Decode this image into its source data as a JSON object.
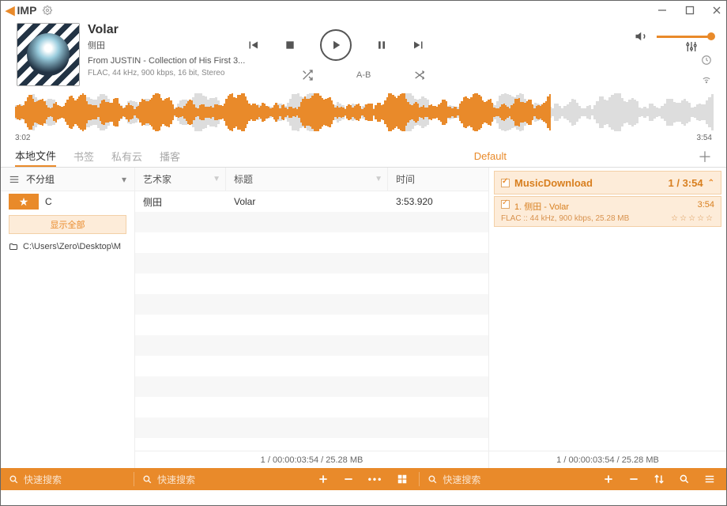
{
  "app_name": "IMP",
  "track": {
    "title": "Volar",
    "artist": "侧田",
    "album": "From JUSTIN - Collection of His First 3...",
    "spec": "FLAC, 44 kHz, 900 kbps, 16 bit, Stereo"
  },
  "mode": {
    "ab": "A-B"
  },
  "time": {
    "current": "3:02",
    "total": "3:54",
    "progress_pct": 77
  },
  "tabs": [
    "本地文件",
    "书签",
    "私有云",
    "播客"
  ],
  "right_title": "Default",
  "left": {
    "group_label": "不分组",
    "star_letter": "C",
    "show_all": "显示全部",
    "folder": "C:\\Users\\Zero\\Desktop\\M"
  },
  "columns": {
    "artist": "艺术家",
    "title": "标题",
    "time": "时间"
  },
  "rows": [
    {
      "artist": "侧田",
      "title": "Volar",
      "time": "3:53.920"
    }
  ],
  "mid_status": "1 / 00:00:03:54 / 25.28 MB",
  "playlist": {
    "header": "MusicDownload",
    "count": "1 / 3:54",
    "items": [
      {
        "label": "1. 侧田 - Volar",
        "dur": "3:54",
        "spec": "FLAC :: 44 kHz, 900 kbps, 25.28 MB",
        "stars": "☆☆☆☆☆"
      }
    ],
    "status": "1 / 00:00:03:54 / 25.28 MB"
  },
  "footer": {
    "search_placeholder": "快速搜索"
  }
}
